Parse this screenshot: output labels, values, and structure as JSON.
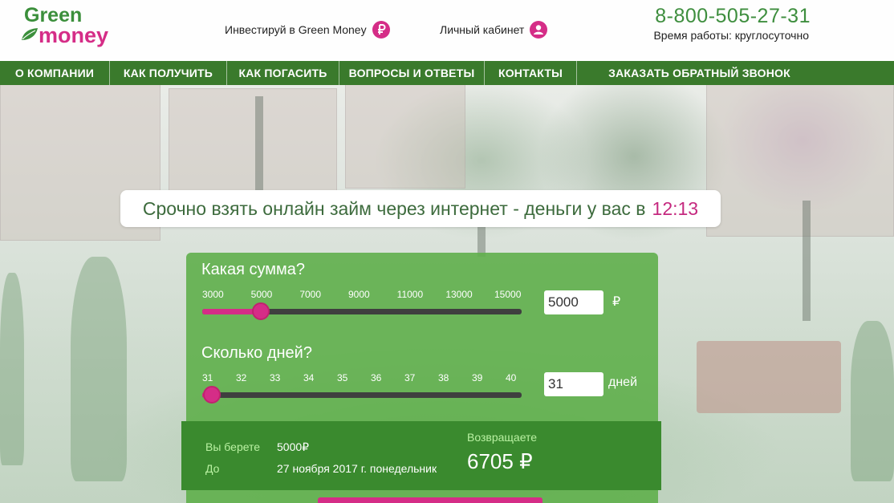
{
  "header": {
    "logo": {
      "line1": "Green",
      "line2": "money"
    },
    "invest_label": "Инвестируй в Green Money",
    "account_label": "Личный кабинет",
    "phone": "8-800-505-27-31",
    "hours": "Время работы: круглосуточно"
  },
  "nav": {
    "items": [
      {
        "label": "О КОМПАНИИ"
      },
      {
        "label": "КАК ПОЛУЧИТЬ"
      },
      {
        "label": "КАК ПОГАСИТЬ"
      },
      {
        "label": "ВОПРОСЫ И ОТВЕТЫ"
      },
      {
        "label": "КОНТАКТЫ"
      },
      {
        "label": "ЗАКАЗАТЬ ОБРАТНЫЙ ЗВОНОК"
      }
    ]
  },
  "headline": {
    "text": "Срочно взять онлайн займ через интернет - деньги у вас в",
    "time": "12:13"
  },
  "amount": {
    "label": "Какая сумма?",
    "ticks": [
      "3000",
      "5000",
      "7000",
      "9000",
      "11000",
      "13000",
      "15000"
    ],
    "min": 3000,
    "max": 15000,
    "value": "5000",
    "value_num": 5000,
    "unit": "₽"
  },
  "days": {
    "label": "Сколько дней?",
    "ticks": [
      "31",
      "32",
      "33",
      "34",
      "35",
      "36",
      "37",
      "38",
      "39",
      "40"
    ],
    "min": 31,
    "max": 40,
    "value": "31",
    "value_num": 31,
    "unit": "дней"
  },
  "summary": {
    "take_label": "Вы берете",
    "take_value": "5000₽",
    "until_label": "До",
    "until_value": "27 ноября 2017 г. понедельник",
    "return_label": "Возвращаете",
    "return_value": "6705 ₽"
  },
  "colors": {
    "brand_green": "#3a7a2c",
    "brand_pink": "#d52d87",
    "panel_green": "#5faf4b",
    "summary_green": "#3a8a2e"
  }
}
